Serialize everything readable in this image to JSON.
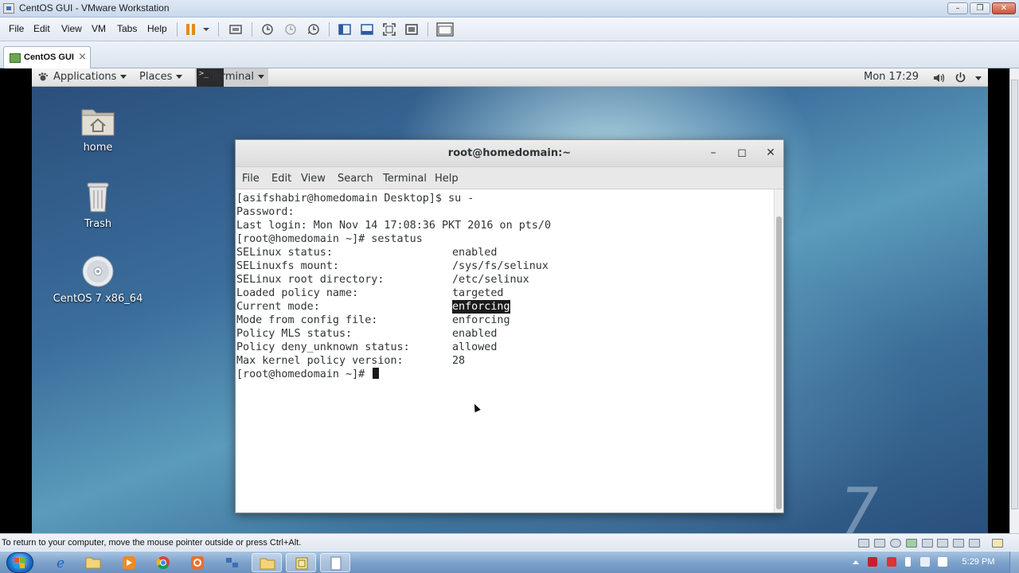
{
  "host_window": {
    "title": "CentOS GUI - VMware Workstation",
    "menus": [
      "File",
      "Edit",
      "View",
      "VM",
      "Tabs",
      "Help"
    ],
    "tab_label": "CentOS GUI",
    "tab_close": "×",
    "minimize": "–",
    "maximize": "❐",
    "close": "✕"
  },
  "gnome_bar": {
    "applications": "Applications",
    "places": "Places",
    "terminal": "Terminal",
    "clock": "Mon 17:29"
  },
  "desktop_icons": [
    {
      "label": "home",
      "icon": "folder-home-icon"
    },
    {
      "label": "Trash",
      "icon": "trash-icon"
    },
    {
      "label": "CentOS 7 x86_64",
      "icon": "disc-icon"
    }
  ],
  "terminal": {
    "title": "root@homedomain:~",
    "menus": [
      "File",
      "Edit",
      "View",
      "Search",
      "Terminal",
      "Help"
    ],
    "lines": [
      "[asifshabir@homedomain Desktop]$ su -",
      "Password:",
      "Last login: Mon Nov 14 17:08:36 PKT 2016 on pts/0",
      "[root@homedomain ~]# sestatus"
    ],
    "status_rows": [
      {
        "key": "SELinux status:",
        "value": "enabled"
      },
      {
        "key": "SELinuxfs mount:",
        "value": "/sys/fs/selinux"
      },
      {
        "key": "SELinux root directory:",
        "value": "/etc/selinux"
      },
      {
        "key": "Loaded policy name:",
        "value": "targeted"
      },
      {
        "key": "Current mode:",
        "value": "enforcing"
      },
      {
        "key": "Mode from config file:",
        "value": "enforcing"
      },
      {
        "key": "Policy MLS status:",
        "value": "enabled"
      },
      {
        "key": "Policy deny_unknown status:",
        "value": "allowed"
      },
      {
        "key": "Max kernel policy version:",
        "value": "28"
      }
    ],
    "prompt": "[root@homedomain ~]# "
  },
  "desktop_watermark": "7",
  "status_bar": {
    "message": "To return to your computer, move the mouse pointer outside or press Ctrl+Alt."
  },
  "taskbar": {
    "clock": "5:29 PM"
  },
  "colors": {
    "terminal_highlight_bg": "#1b1b1b",
    "terminal_text": "#2e3436",
    "taskbar": "#7ea3cc"
  }
}
